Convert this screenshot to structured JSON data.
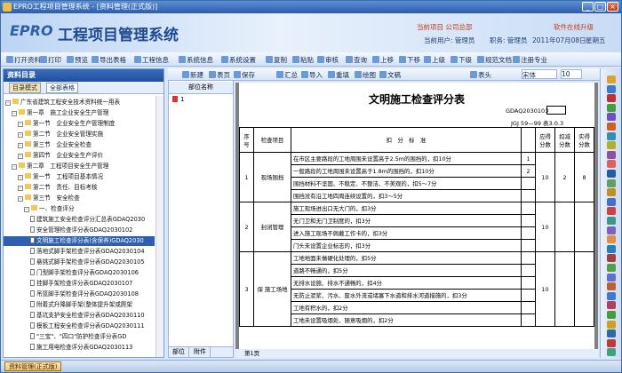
{
  "window": {
    "title": "EPRO工程项目管理系统 - [资料管理(正式版)]",
    "min": "_",
    "max": "□",
    "close": "×"
  },
  "banner": {
    "logo": "EPRO",
    "app_title": "工程项目管理系统",
    "link1": "当前项目 公司总部",
    "link2": "软件在线升级",
    "user_label": "当前用户: 管理员",
    "role_label": "职务: 管理员",
    "date": "2011年07月08日",
    "weekday": "星期五"
  },
  "toolbar1": [
    "打开资料",
    "打印",
    "预览",
    "导出表格",
    "工程信息",
    "系统信息",
    "系统设置",
    "复制",
    "粘贴",
    "审核",
    "查询",
    "上移",
    "下移",
    "上级",
    "下级",
    "规范文档",
    "注册专业"
  ],
  "doctoolbar": [
    "新建",
    "表页",
    "保存",
    "汇总",
    "导入",
    "重填",
    "绘图",
    "文稿",
    "表头"
  ],
  "doctoolbar_font": "宋体",
  "doctoolbar_size": "10",
  "left": {
    "header": "资料目录",
    "tab1": "目录模式",
    "tab2": "全部表格",
    "tree": [
      {
        "t": "广东省建筑工程安全技术资料统一用表",
        "lv": 0,
        "k": "fold"
      },
      {
        "t": "第一章　施工企业安全生产管理",
        "lv": 1,
        "k": "fold"
      },
      {
        "t": "第一节　企业安全生产管理制度",
        "lv": 2,
        "k": "fold"
      },
      {
        "t": "第二节　企业安全管理实施",
        "lv": 2,
        "k": "fold"
      },
      {
        "t": "第三节　企业安全检查",
        "lv": 2,
        "k": "fold"
      },
      {
        "t": "第四节　企业安全生产评价",
        "lv": 2,
        "k": "fold"
      },
      {
        "t": "第二章　工程项目安全生产管理",
        "lv": 1,
        "k": "fold"
      },
      {
        "t": "第一节　工程项目基本情况",
        "lv": 2,
        "k": "fold"
      },
      {
        "t": "第二节　责任、目标考核",
        "lv": 2,
        "k": "fold"
      },
      {
        "t": "第三节　安全检查",
        "lv": 2,
        "k": "fold"
      },
      {
        "t": "一、检查评分",
        "lv": 3,
        "k": "fold"
      },
      {
        "t": "建筑施工安全检查评分汇总表GDAQ2030",
        "lv": 4,
        "k": "doc"
      },
      {
        "t": "安全管理检查评分表GDAQ2030102",
        "lv": 4,
        "k": "doc"
      },
      {
        "t": "文明施工检查评分表(含保养)GDAQ2030",
        "lv": 4,
        "k": "doc",
        "sel": true
      },
      {
        "t": "落地式脚手架检查评分表GDAQ2030104",
        "lv": 4,
        "k": "doc"
      },
      {
        "t": "悬挑式脚手架检查评分表GDAQ2030105",
        "lv": 4,
        "k": "doc"
      },
      {
        "t": "门型脚手架检查评分表GDAQ2030106",
        "lv": 4,
        "k": "doc"
      },
      {
        "t": "挂脚手架检查评分表GDAQ2030107",
        "lv": 4,
        "k": "doc"
      },
      {
        "t": "吊篮脚手架检查评分表GDAQ2030108",
        "lv": 4,
        "k": "doc"
      },
      {
        "t": "附着式升降脚手架(整体提升架或爬架",
        "lv": 4,
        "k": "doc"
      },
      {
        "t": "基坑支护安全检查评分表GDAQ2030110",
        "lv": 4,
        "k": "doc"
      },
      {
        "t": "模板工程安全检查评分表GDAQ2030111",
        "lv": 4,
        "k": "doc"
      },
      {
        "t": "\"三宝\"、\"四口\"防护检查评分表GD",
        "lv": 4,
        "k": "doc"
      },
      {
        "t": "施工用电检查评分表GDAQ2030113",
        "lv": 4,
        "k": "doc"
      }
    ]
  },
  "mid": {
    "header": "部位名称",
    "row1": "1",
    "tab1": "部位",
    "tab2": "附件"
  },
  "doc": {
    "title": "文明施工检查评分表",
    "code": "GDAQ2030103",
    "std": "JGJ 59—99 表3.0.3",
    "headers": [
      "序号",
      "检查项目",
      "扣　分　标　准",
      "",
      "应得分数",
      "扣减分数",
      "实得分数"
    ],
    "rows": [
      {
        "no": "1",
        "item": "现场围挡",
        "sub": "",
        "stds": [
          [
            "在市区主要路段的工地周围未设置高于2.5m的围挡的，扣10分",
            "1"
          ],
          [
            "一般路段的工地周围未设置高于1.8m的围挡的，扣10分",
            "2"
          ],
          [
            "围挡材料不坚固、不稳定、不整洁、不美观的，扣5～7分",
            ""
          ],
          [
            "围挡没有沿工地四周连续设置的，扣3～5分",
            ""
          ]
        ],
        "should": "10",
        "deduct": "2",
        "actual": "8"
      },
      {
        "no": "2",
        "item": "封闭管理",
        "sub": "",
        "stds": [
          [
            "施工现场进出口无大门的，扣3分",
            ""
          ],
          [
            "无门卫和无门卫制度的，扣3分",
            ""
          ],
          [
            "进入施工现场不佩戴工作卡的，扣3分",
            ""
          ],
          [
            "门头未设置企业标志的，扣3分",
            ""
          ]
        ],
        "should": "10",
        "deduct": "",
        "actual": ""
      },
      {
        "no": "3",
        "item": "施工场地",
        "sub": "保",
        "stds": [
          [
            "工地地面未做硬化处理的，扣5分",
            ""
          ],
          [
            "道路不畅通的，扣5分",
            ""
          ],
          [
            "无排水设施、排水不通畅的，扣4分",
            ""
          ],
          [
            "无防止泥浆、污水、废水外流或堵塞下水道和排水河道措施的，扣3分",
            ""
          ],
          [
            "工地有积水的，扣2分",
            ""
          ],
          [
            "工地未设置吸烟处、随意吸烟的，扣2分",
            ""
          ]
        ],
        "should": "10",
        "deduct": "",
        "actual": ""
      }
    ]
  },
  "pager": "第1页",
  "status": {
    "task": "资料管理(正式版)"
  }
}
